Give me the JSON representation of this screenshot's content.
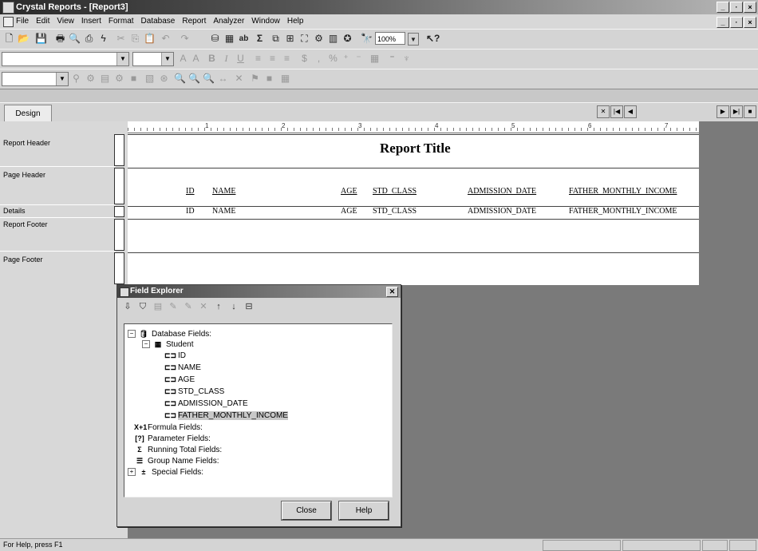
{
  "window": {
    "title": "Crystal Reports - [Report3]",
    "buttons": [
      "_",
      "·",
      "×"
    ]
  },
  "menu": {
    "items": [
      "File",
      "Edit",
      "View",
      "Insert",
      "Format",
      "Database",
      "Report",
      "Analyzer",
      "Window",
      "Help"
    ]
  },
  "toolbar": {
    "zoom_value": "100%",
    "bold": "B",
    "italic": "I",
    "underline": "U"
  },
  "tabs": {
    "design": "Design"
  },
  "sections": [
    "Report Header",
    "Page Header",
    "Details",
    "Report Footer",
    "Page Footer"
  ],
  "ruler": {
    "marks": [
      "1",
      "2",
      "3",
      "4",
      "5",
      "6",
      "7"
    ]
  },
  "report": {
    "title": "Report Title",
    "page_header_fields": [
      "ID",
      "NAME",
      "AGE",
      "STD_CLASS",
      "ADMISSION_DATE",
      "FATHER_MONTHLY_INCOME"
    ],
    "detail_fields": [
      "ID",
      "NAME",
      "AGE",
      "STD_CLASS",
      "ADMISSION_DATE",
      "FATHER_MONTHLY_INCOME"
    ]
  },
  "field_explorer": {
    "title": "Field Explorer",
    "tree": {
      "database_fields": "Database Fields:",
      "table": "Student",
      "fields": [
        "ID",
        "NAME",
        "AGE",
        "STD_CLASS",
        "ADMISSION_DATE",
        "FATHER_MONTHLY_INCOME"
      ],
      "selected": "FATHER_MONTHLY_INCOME",
      "formula": "Formula Fields:",
      "parameter": "Parameter Fields:",
      "running_total": "Running Total Fields:",
      "group_name": "Group Name Fields:",
      "special": "Special Fields:"
    },
    "close_label": "Close",
    "help_label": "Help"
  },
  "status": {
    "text": "For Help, press F1"
  }
}
